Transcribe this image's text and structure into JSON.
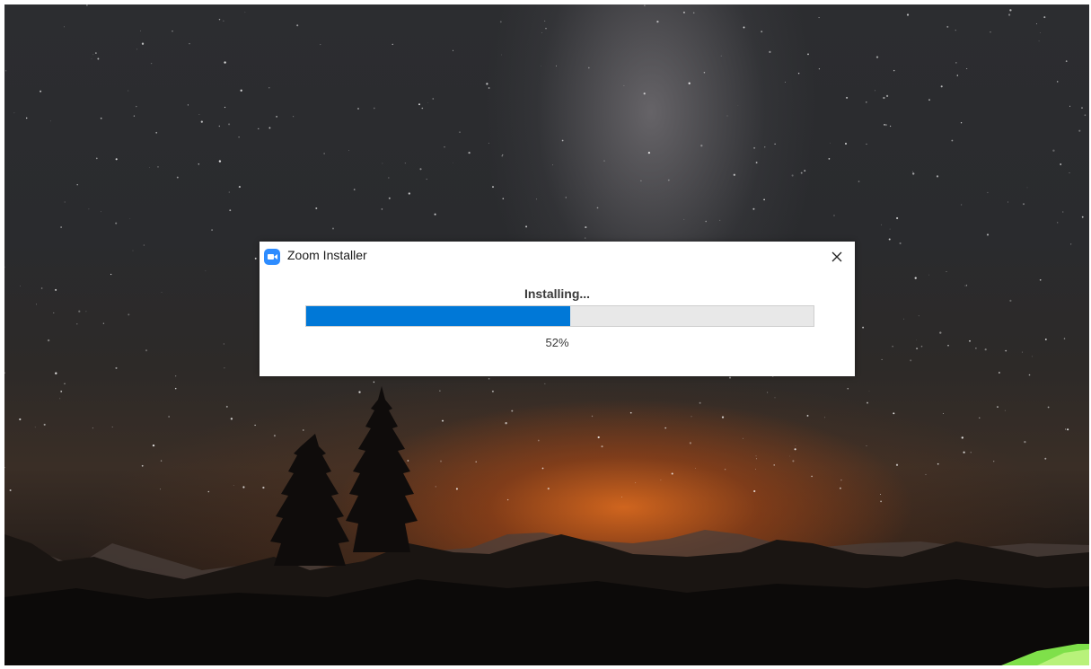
{
  "dialog": {
    "title": "Zoom Installer",
    "app_icon": "zoom-camera-icon",
    "close_icon": "close-icon",
    "status": "Installing...",
    "progress_percent": 52,
    "progress_label": "52%",
    "progress_color": "#0078d7",
    "app_icon_color": "#2d8cff"
  },
  "desktop": {
    "wallpaper": "night sky with milky way over mountains and pine trees at sunset"
  }
}
